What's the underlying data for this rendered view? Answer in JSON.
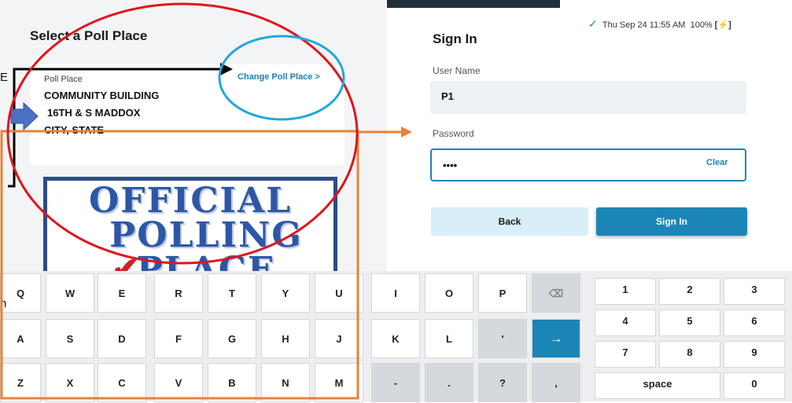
{
  "status_bar": {
    "check_icon": "check-icon",
    "datetime": "Thu Sep 24  11:55 AM",
    "battery": "100%",
    "battery_icon": "battery-charging-icon"
  },
  "left_panel": {
    "title": "Select a Poll Place",
    "poll_place_label": "Poll Place",
    "poll_place_lines": [
      "COMMUNITY BUILDING",
      "16TH & S MADDOX",
      "CITY, STATE"
    ],
    "change_link": "Change Poll Place >",
    "poster_lines": [
      "OFFICIAL",
      "POLLING",
      "PLACE"
    ],
    "edge_text": [
      "E",
      "n"
    ]
  },
  "sign_in": {
    "title": "Sign In",
    "username_label": "User Name",
    "username_value": "P1",
    "password_label": "Password",
    "password_value": "••••",
    "clear_label": "Clear",
    "back_label": "Back",
    "signin_label": "Sign In"
  },
  "keyboard": {
    "rows": [
      [
        "Q",
        "W",
        "E",
        "R",
        "T",
        "Y",
        "U",
        "I",
        "O",
        "P",
        "⌫"
      ],
      [
        "A",
        "S",
        "D",
        "F",
        "G",
        "H",
        "J",
        "K",
        "L",
        "'",
        "→"
      ],
      [
        "Z",
        "X",
        "C",
        "V",
        "B",
        "N",
        "M",
        "-",
        ".",
        "?",
        ","
      ]
    ],
    "numpad": [
      [
        "1",
        "2",
        "3"
      ],
      [
        "4",
        "5",
        "6"
      ],
      [
        "7",
        "8",
        "9"
      ],
      [
        "space",
        "0"
      ]
    ]
  },
  "annotations": {
    "red_ellipse": "#e0141c",
    "blue_ellipse": "#1ea8e0",
    "orange": "#e8823a",
    "arrow_fill": "#4a72c4"
  }
}
